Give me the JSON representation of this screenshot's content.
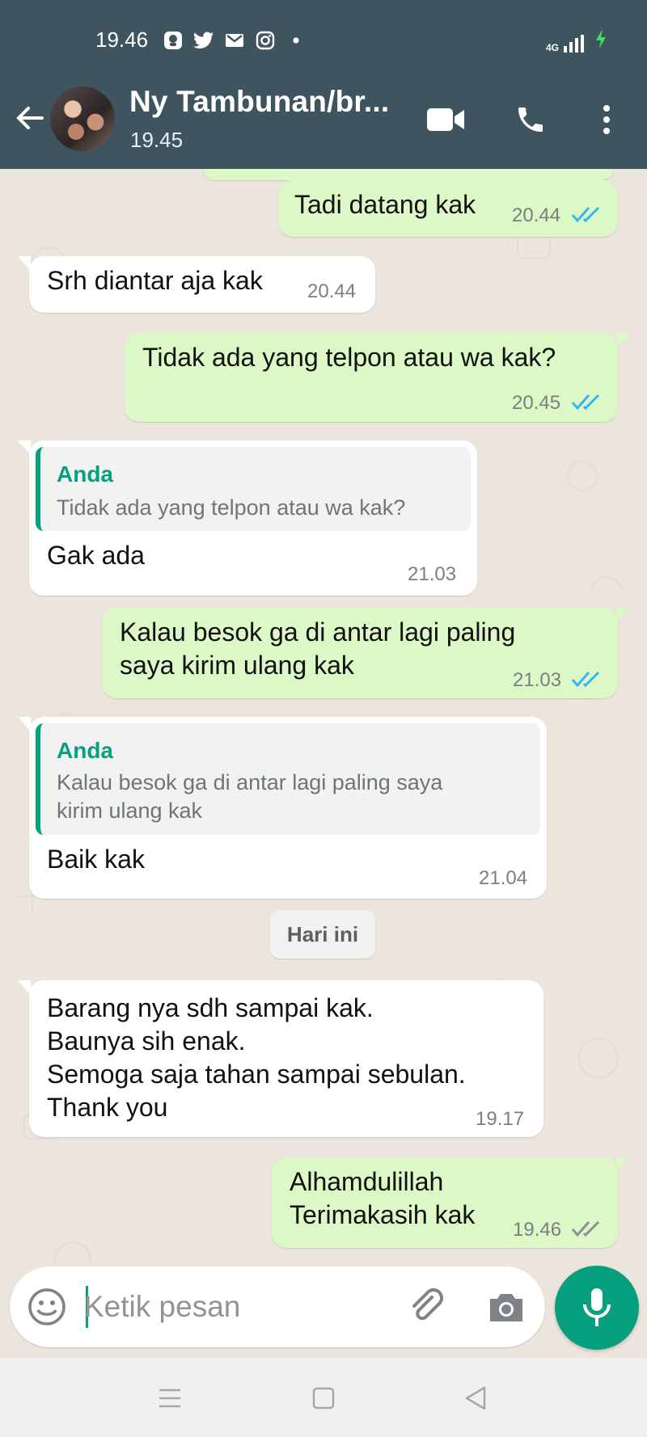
{
  "status_bar": {
    "time": "19.46",
    "network": "4G",
    "icons": [
      "app-icon",
      "twitter-icon",
      "gmail-icon",
      "instagram-icon",
      "dot-icon"
    ]
  },
  "header": {
    "contact_name": "Ny Tambunan/br...",
    "last_seen": "19.45",
    "icon_color": "#ffffff",
    "background": "#3e5560"
  },
  "messages": [
    {
      "dir": "out",
      "text": "Tadi datang kak",
      "time": "20.44",
      "read": true
    },
    {
      "dir": "in",
      "text": "Srh diantar aja kak",
      "time": "20.44"
    },
    {
      "dir": "out",
      "text": "Tidak ada yang telpon atau wa kak?",
      "time": "20.45",
      "read": true
    },
    {
      "dir": "in",
      "quote_author": "Anda",
      "quote_text": "Tidak ada yang telpon atau wa kak?",
      "text": "Gak ada",
      "time": "21.03"
    },
    {
      "dir": "out",
      "text": "Kalau besok ga di antar lagi paling\nsaya kirim ulang kak",
      "time": "21.03",
      "read": true
    },
    {
      "dir": "in",
      "quote_author": "Anda",
      "quote_text": "Kalau besok ga di antar lagi paling saya\nkirim ulang kak",
      "text": "Baik kak",
      "time": "21.04"
    },
    {
      "dir": "in",
      "text": "Barang nya sdh sampai kak.\nBaunya sih enak.\nSemoga saja tahan sampai sebulan.\nThank you",
      "time": "19.17"
    },
    {
      "dir": "out",
      "text": "Alhamdulillah\nTerimakasih kak",
      "time": "19.46",
      "read": false
    }
  ],
  "date_separator": "Hari ini",
  "composer": {
    "placeholder": "Ketik pesan"
  },
  "colors": {
    "accent": "#06a07e",
    "outgoing_bubble": "#dcf8c6",
    "incoming_bubble": "#ffffff",
    "read_ticks": "#34b7f1",
    "delivered_ticks": "#8c9193"
  }
}
